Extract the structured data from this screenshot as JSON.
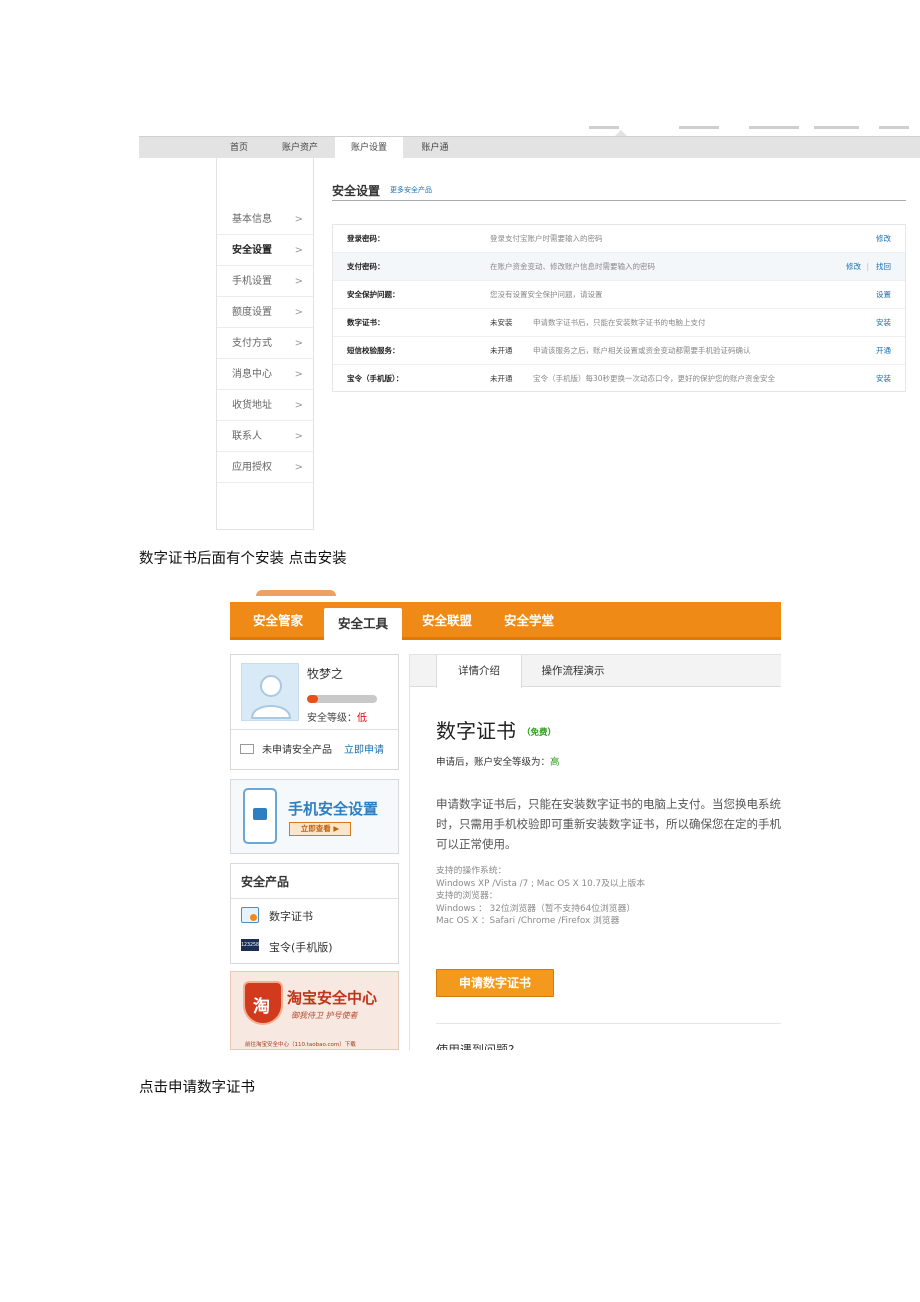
{
  "screenshot1": {
    "topnav": [
      "首页",
      "账户资产",
      "账户设置",
      "账户通"
    ],
    "sidebar": [
      {
        "label": "基本信息",
        "arrow": ">"
      },
      {
        "label": "安全设置",
        "arrow": ">"
      },
      {
        "label": "手机设置",
        "arrow": ">"
      },
      {
        "label": "额度设置",
        "arrow": ">"
      },
      {
        "label": "支付方式",
        "arrow": ">"
      },
      {
        "label": "消息中心",
        "arrow": ">"
      },
      {
        "label": "收货地址",
        "arrow": ">"
      },
      {
        "label": "联系人",
        "arrow": ">"
      },
      {
        "label": "应用授权",
        "arrow": ">"
      }
    ],
    "section_title": "安全设置",
    "section_more": "更多安全产品",
    "rows": [
      {
        "name": "登录密码：",
        "status": "",
        "desc": "登录支付宝账户时需要输入的密码",
        "action": "修改",
        "action2": ""
      },
      {
        "name": "支付密码：",
        "status": "",
        "desc": "在账户资金变动、修改账户信息时需要输入的密码",
        "action": "找回",
        "action2": "修改",
        "sep": "|"
      },
      {
        "name": "安全保护问题：",
        "status": "",
        "desc": "您没有设置安全保护问题，请设置",
        "action": "设置",
        "action2": ""
      },
      {
        "name": "数字证书：",
        "status": "未安装",
        "desc": "申请数字证书后，只能在安装数字证书的电脑上支付",
        "action": "安装",
        "action2": ""
      },
      {
        "name": "短信校验服务：",
        "status": "未开通",
        "desc": "申请该服务之后，账户相关设置或资金变动都需要手机验证码确认",
        "action": "开通",
        "action2": ""
      },
      {
        "name": "宝令（手机版）：",
        "status": "未开通",
        "desc": "宝令（手机版）每30秒更换一次动态口令，更好的保护您的账户资金安全",
        "action": "安装",
        "action2": ""
      }
    ]
  },
  "caption1": "数字证书后面有个安装  点击安装",
  "screenshot2": {
    "tabs": [
      "安全管家",
      "安全工具",
      "安全联盟",
      "安全学堂"
    ],
    "user": {
      "name": "牧梦之",
      "level_label": "安全等级：",
      "level_value": "低",
      "level_fraction": 0.15,
      "unapplied": "未申请安全产品",
      "apply_now": "立即申请"
    },
    "phone_promo": {
      "title": "手机安全设置",
      "button": "立即查看 ▶"
    },
    "products": {
      "title": "安全产品",
      "items": [
        "数字证书",
        "宝令(手机版)"
      ],
      "token_icon_text": "123258"
    },
    "taobao": {
      "glyph": "淘",
      "title": "淘宝安全中心",
      "slogan": "御我侍卫  护号使者",
      "foot": "前往淘宝安全中心（110.taobao.com）下载"
    },
    "content_tabs": [
      "详情介绍",
      "操作流程演示"
    ],
    "cert_title": "数字证书",
    "cert_free": "（免费）",
    "after_apply": "申请后，账户安全等级为：",
    "after_level": "高",
    "description": "申请数字证书后，只能在安装数字证书的电脑上支付。当您换电系统时，只需用手机校验即可重新安装数字证书，所以确保您在定的手机可以正常使用。",
    "os_lines": [
      "支持的操作系统：",
      "Windows XP /Vista /7 ; Mac OS X 10.7及以上版本",
      "支持的浏览器：",
      "Windows ： 32位浏览器（暂不支持64位浏览器）",
      "Mac OS X ：Safari /Chrome /Firefox 浏览器"
    ],
    "apply_button": "申请数字证书",
    "faq": "使用遇到问题?"
  },
  "caption2": "点击申请数字证书"
}
